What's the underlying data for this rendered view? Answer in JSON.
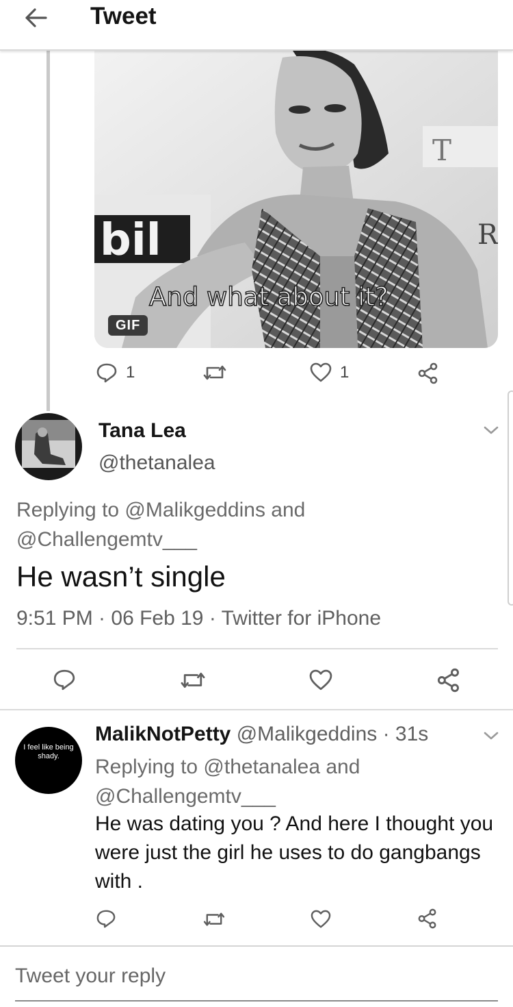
{
  "header": {
    "title": "Tweet",
    "back_icon": "arrow-left-icon"
  },
  "gif_tweet": {
    "gif_caption": "And what about it?",
    "gif_badge": "GIF",
    "logo_text_left": "bil",
    "logo_text_right": "T",
    "logo_text_r": "R",
    "actions": {
      "reply_count": "1",
      "retweet_count": "",
      "like_count": "1"
    }
  },
  "main_tweet": {
    "display_name": "Tana Lea",
    "handle": "@thetanalea",
    "replying_line1": "Replying to @Malikgeddins and",
    "replying_line2": "@Challengemtv___",
    "text": "He wasn’t single",
    "meta": "9:51 PM · 06 Feb 19 · Twitter for iPhone"
  },
  "reply_tweet": {
    "display_name": "MalikNotPetty",
    "handle_time": " @Malikgeddins · 31s",
    "avatar_text": "I feel like being shady.",
    "replying_line1": "Replying to @thetanalea and",
    "replying_line2": "@Challengemtv___",
    "text": "He was dating you ? And here I thought you were just the girl he uses to do gangbangs with ."
  },
  "composer": {
    "placeholder": "Tweet your reply"
  },
  "icons": [
    "reply-icon",
    "retweet-icon",
    "heart-icon",
    "share-icon",
    "chevron-down-icon"
  ]
}
